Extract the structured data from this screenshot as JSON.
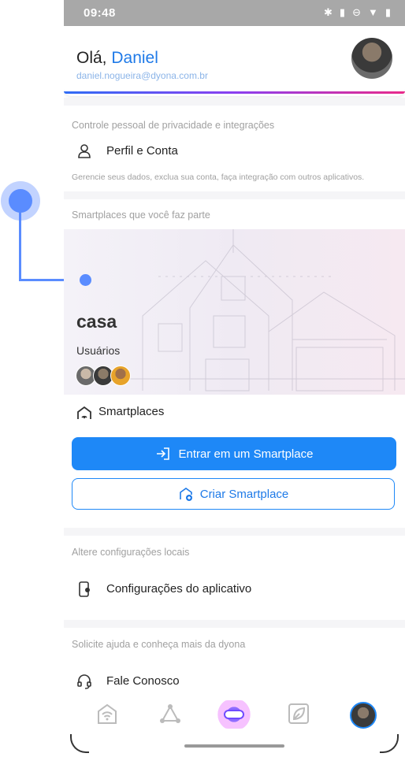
{
  "status_bar": {
    "time": "09:48",
    "icons": [
      "bluetooth-icon",
      "vibrate-icon",
      "dnd-icon",
      "wifi-icon",
      "battery-icon"
    ]
  },
  "header": {
    "greeting_prefix": "Olá, ",
    "user_name": "Daniel",
    "email": "daniel.nogueira@dyona.com.br"
  },
  "privacy_section": {
    "title": "Controle pessoal de privacidade e integrações",
    "item_label": "Perfil e Conta",
    "helper": "Gerencie seus dados, exclua sua conta, faça integração com outros aplicativos."
  },
  "smartplaces_section": {
    "title": "Smartplaces que você faz parte",
    "card_name": "casa",
    "users_label": "Usuários",
    "list_label": "Smartplaces",
    "join_button": "Entrar em um Smartplace",
    "create_button": "Criar Smartplace"
  },
  "local_section": {
    "title": "Altere configurações locais",
    "item_label": "Configurações do aplicativo"
  },
  "help_section": {
    "title": "Solicite ajuda e conheça mais da dyona",
    "item_label": "Fale Conosco"
  },
  "colors": {
    "accent": "#1e88f7",
    "name": "#1f7ae8",
    "muted": "#a0a0a0"
  },
  "bottom_nav": [
    "home-wifi-icon",
    "network-icon",
    "dyona-logo-icon",
    "leaf-icon",
    "profile-avatar"
  ]
}
